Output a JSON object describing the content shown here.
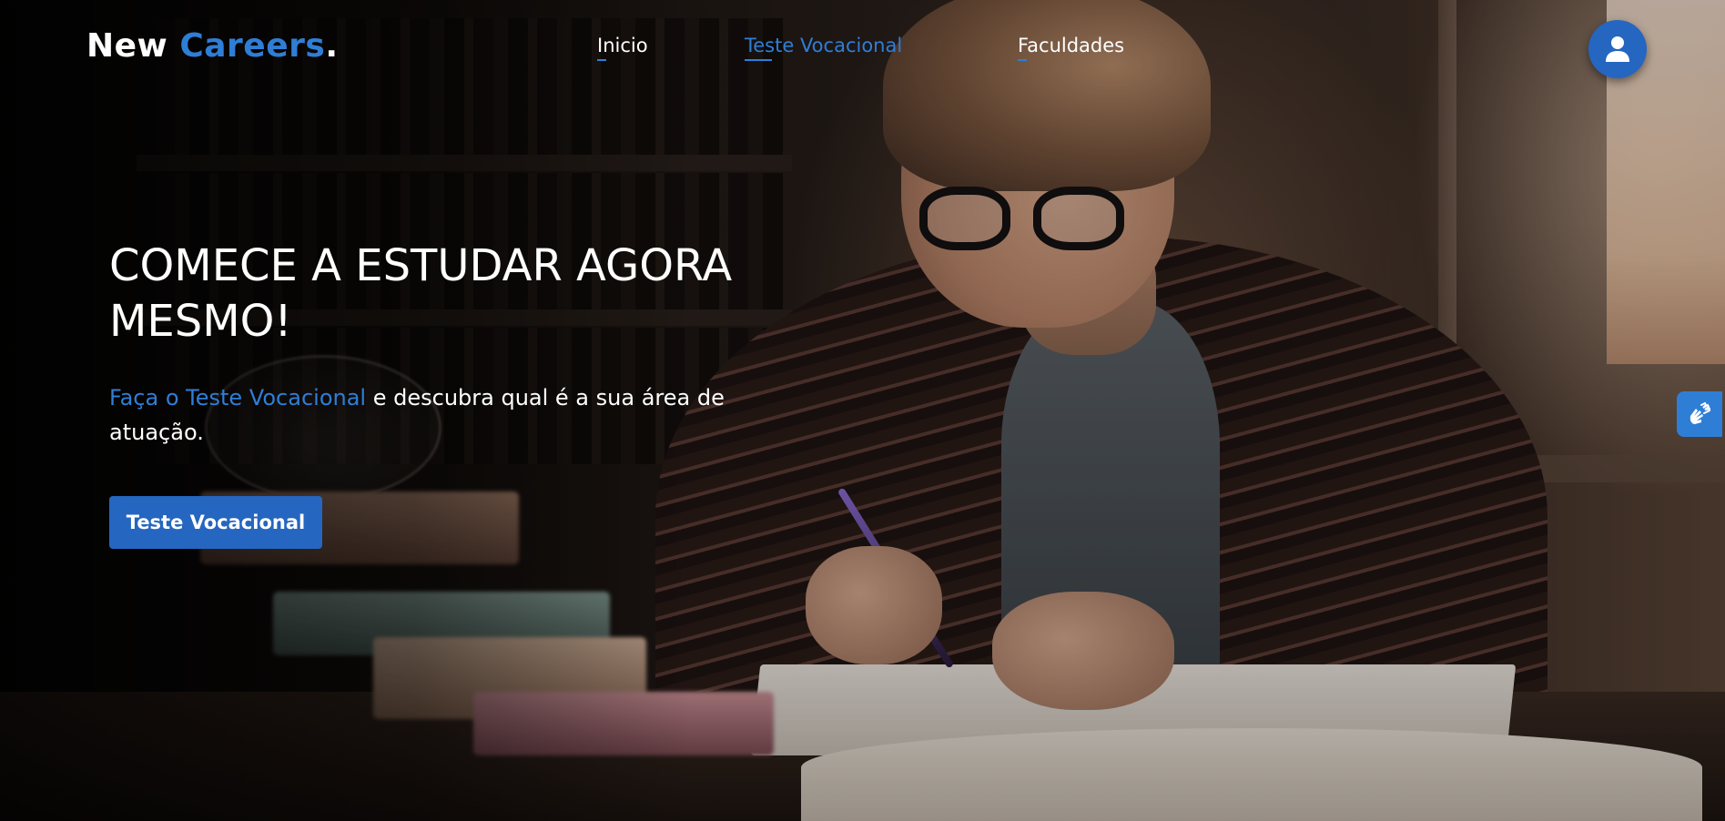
{
  "header": {
    "logo": {
      "part1": "New ",
      "part2": "Careers",
      "dot": "."
    },
    "nav": [
      {
        "label": "Inicio",
        "active": false
      },
      {
        "label": "Teste Vocacional",
        "active": true
      },
      {
        "label": "Faculdades",
        "active": false
      }
    ],
    "user_icon": "user-icon"
  },
  "hero": {
    "title_line1": "COMECE A ESTUDAR AGORA",
    "title_line2": "MESMO!",
    "subtitle_link": "Faça o Teste Vocacional",
    "subtitle_rest": " e descubra qual é a sua área de atuação.",
    "cta_label": "Teste Vocacional"
  },
  "accessibility": {
    "icon": "sign-language-icon"
  },
  "colors": {
    "accent": "#2f7ed6",
    "button": "#2566c0",
    "text": "#ffffff"
  }
}
